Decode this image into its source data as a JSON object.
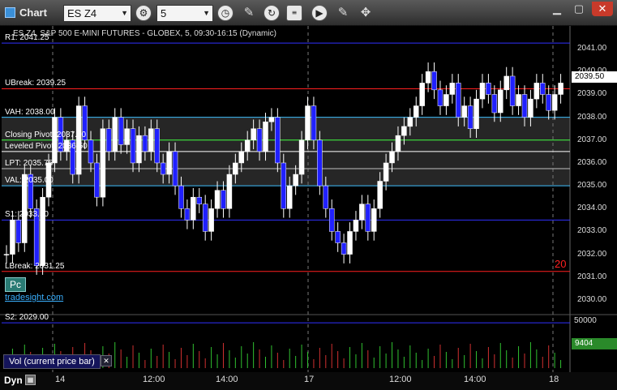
{
  "window": {
    "title": "Chart"
  },
  "toolbar": {
    "symbol": "ES Z4",
    "interval": "5"
  },
  "chart_header": "ES Z4, S&P 500 E-MINI FUTURES - GLOBEX, 5, 09:30-16:15 (Dynamic)",
  "levels": [
    {
      "label": "R1: 2041.25",
      "price": 2041.25,
      "color": "#3030ff"
    },
    {
      "label": "UBreak: 2039.25",
      "price": 2039.25,
      "color": "#ff2020"
    },
    {
      "label": "VAH: 2038.00",
      "price": 2038.0,
      "color": "#40c0ff"
    },
    {
      "label": "Closing Pivot: 2037.00",
      "price": 2037.0,
      "color": "#40ff40"
    },
    {
      "label": "Leveled Pivot: 2036.50",
      "price": 2036.5,
      "color": "#ffffff"
    },
    {
      "label": "LPT: 2035.75",
      "price": 2035.75,
      "color": "#c0c0c0"
    },
    {
      "label": "VAL: 2035.00",
      "price": 2035.0,
      "color": "#40c0ff"
    },
    {
      "label": "S1: 2033.50",
      "price": 2033.5,
      "color": "#3030ff"
    },
    {
      "label": "LBreak: 2031.25",
      "price": 2031.25,
      "color": "#ff2020"
    },
    {
      "label": "S2: 2029.00",
      "price": 2029.0,
      "color": "#3030ff"
    }
  ],
  "price_axis": {
    "ticks": [
      "2041.00",
      "2040.00",
      "2039.00",
      "2038.00",
      "2037.00",
      "2036.00",
      "2035.00",
      "2034.00",
      "2033.00",
      "2032.00",
      "2031.00",
      "2030.00"
    ],
    "current_price": "2039.50"
  },
  "volume": {
    "label": "Vol (current price bar)",
    "axis_top": "50000",
    "current": "9404"
  },
  "time_axis": [
    "14",
    "12:00",
    "14:00",
    "17",
    "12:00",
    "14:00",
    "18"
  ],
  "badges": {
    "pc": "Pc",
    "brand": "tradesight.com",
    "dyn": "Dyn",
    "right_count": "20"
  },
  "chart_data": {
    "type": "candlestick",
    "title": "ES Z4, S&P 500 E-MINI FUTURES - GLOBEX, 5, 09:30-16:15 (Dynamic)",
    "ylim": [
      2029.5,
      2042.0
    ],
    "closes": [
      2032.0,
      2033.5,
      2032.5,
      2035.5,
      2034.0,
      2031.5,
      2034.5,
      2036.0,
      2038.0,
      2036.5,
      2037.0,
      2035.5,
      2038.5,
      2037.0,
      2036.0,
      2034.5,
      2037.5,
      2036.5,
      2038.0,
      2036.8,
      2037.5,
      2036.0,
      2037.2,
      2036.5,
      2037.5,
      2036.0,
      2035.5,
      2036.5,
      2035.0,
      2034.0,
      2033.5,
      2034.5,
      2034.2,
      2033.0,
      2034.0,
      2034.8,
      2034.0,
      2035.5,
      2036.0,
      2036.5,
      2037.0,
      2037.5,
      2036.5,
      2037.8,
      2038.0,
      2036.0,
      2034.0,
      2035.0,
      2035.5,
      2037.0,
      2038.5,
      2037.0,
      2035.0,
      2034.0,
      2033.0,
      2032.5,
      2032.0,
      2033.0,
      2033.5,
      2034.2,
      2033.0,
      2034.0,
      2035.2,
      2036.0,
      2036.5,
      2037.2,
      2037.6,
      2038.0,
      2038.5,
      2039.5,
      2040.0,
      2039.2,
      2038.5,
      2039.0,
      2039.5,
      2038.0,
      2038.5,
      2037.5,
      2038.8,
      2039.5,
      2039.0,
      2038.2,
      2039.2,
      2039.8,
      2038.5,
      2039.0,
      2038.0,
      2038.8,
      2039.5,
      2039.0,
      2038.3,
      2039.0,
      2039.5
    ]
  }
}
